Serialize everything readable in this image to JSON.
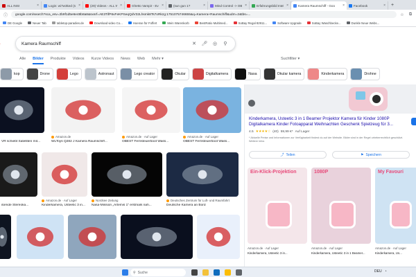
{
  "tabs": [
    {
      "label": "ALL INSI",
      "fav": "#c00"
    },
    {
      "label": "Login: wi7w3ked (sun-gc",
      "fav": "#4285f4"
    },
    {
      "label": "(29) Videos - ALL WHE",
      "fav": "#ff0000"
    },
    {
      "label": "Ghetto Vampir - Everyth",
      "fav": "#ff0000"
    },
    {
      "label": "(sun gun 1?",
      "fav": "#5f6368"
    },
    {
      "label": "Mind Control -> OBLETE",
      "fav": "#7b68ee"
    },
    {
      "label": "Erfahrungsbild Intelen v",
      "fav": "#34a853"
    },
    {
      "label": "Kamera Raumschiff - Goo",
      "fav": "#4285f4",
      "active": true
    },
    {
      "label": "Facebook",
      "fav": "#1877f2"
    }
  ],
  "tab_close": "×",
  "newtab": "+",
  "address": {
    "url": "google.com/search?sca_esv=2b9f1d5e6e48b8a8&sxsrf=AE3TifP6vFeKPSeqQdV32Lhsmk8Ts7oRkzg:1751075746655&q=Kamera+Raumschiff&udm=2&tbs=..."
  },
  "bookmarks": [
    {
      "label": "DE Google",
      "fav": "#4285f4"
    },
    {
      "label": "Neuer Tab",
      "fav": "#5f6368"
    },
    {
      "label": "tabletop-paradies.de",
      "fav": "#999"
    },
    {
      "label": "Download video Co...",
      "fav": "#ff0000"
    },
    {
      "label": "Hoense für Foffert",
      "fav": "#1877f2"
    },
    {
      "label": "Mein Warenkorb",
      "fav": "#34a853"
    },
    {
      "label": "BestRatio Multimed...",
      "fav": "#ea4335"
    },
    {
      "label": "SoBay Regal 82911...",
      "fav": "#e53238"
    },
    {
      "label": "Software Upgrade",
      "fav": "#4285f4"
    },
    {
      "label": "SoBay Waschbecke...",
      "fav": "#e53238"
    },
    {
      "label": "Dunkle Neue Webs...",
      "fav": "#5f6368"
    }
  ],
  "search": {
    "logo": "e",
    "query": "Kamera Raumschiff"
  },
  "nav": {
    "tabs": [
      "Alle",
      "Bilder",
      "Produkte",
      "Videos",
      "Kurze Videos",
      "News",
      "Web",
      "Mehr ▾"
    ],
    "active": "Bilder",
    "tools": "Suchfilter ▾"
  },
  "chips": [
    {
      "label": "kop",
      "color": "#8d9aa8"
    },
    {
      "label": "Drone",
      "color": "#444"
    },
    {
      "label": "Lego",
      "color": "#d43f3a"
    },
    {
      "label": "Astronaut",
      "color": "#bcc4cc"
    },
    {
      "label": "Lego creator",
      "color": "#7a8fa6"
    },
    {
      "label": "Okular",
      "color": "#222"
    },
    {
      "label": "Digitalkamera",
      "color": "#c44"
    },
    {
      "label": "Nasa",
      "color": "#111"
    },
    {
      "label": "Okular kamera",
      "color": "#333"
    },
    {
      "label": "Kinderkamera",
      "color": "#e88"
    },
    {
      "label": "Drohne",
      "color": "#6a8fb0"
    }
  ],
  "row1": [
    {
      "src": "",
      "title": "VR schiebt Satelliten mit...",
      "color": "#0b1020"
    },
    {
      "src": "Amazon.de",
      "title": "WLToys Q282 J Kamera Raumschiff...",
      "color": "#f3f3f3"
    },
    {
      "src": "Amazon.de · Auf Lager",
      "title": "OBEST Fernsteuerboot Wass...",
      "color": "#f5f5f5"
    },
    {
      "src": "Amazon.de · Auf Lager",
      "title": "OBEST Fernsteuerboot Wass...",
      "color": "#7ab3e0"
    }
  ],
  "row2": [
    {
      "src": "",
      "title": "ißende Stereoka...",
      "color": "#1a1a1a"
    },
    {
      "src": "Amazon.de · Auf Lager",
      "title": "Kinderkamera, Usteetic 3 in...",
      "color": "#f0e8e8"
    },
    {
      "src": "Nordsee Zeitung",
      "title": "Nasa-Mission „Artemis 1\" erstmals nah...",
      "color": "#050505"
    },
    {
      "src": "Deutsches Zentrum für Luft- und Raumfahrt",
      "title": "Deutsche Kamera an Bord",
      "color": "#1c2a44"
    }
  ],
  "row3": [
    {
      "color": "#0e1420"
    },
    {
      "color": "#cfe3f5"
    },
    {
      "color": "#8fa6bd"
    },
    {
      "color": "#0a0f1e"
    },
    {
      "color": "#e9f0fb"
    }
  ],
  "panel": {
    "title": "Kinderkamera, Usteetic 3 in 1 Beamer Projektor Kamera für Kinder 1080P Digitalkamera Kinder Fotoapparat Weihnachten Geschenk Spielzeug für 3...",
    "rating": "4.5",
    "stars": "★★★★☆",
    "count": "(40)",
    "price": "59,99 €*",
    "stock": "Auf Lager",
    "note": "* Aktuelle Preise und Informationen zur Verfügbarkeit findest du auf der Website. Bilder sind in der Regel urheberrechtlich geschützt. Weitere Infos",
    "share": "Teilen",
    "save": "Speichern",
    "ads": [
      {
        "src": "Amazon.de · Auf Lager",
        "title": "Kinderkamera, Usteetic 3 in...",
        "color": "#f4e6ea",
        "banner": "Ein-Klick-Projektion"
      },
      {
        "src": "Amazon.de · Auf Lager",
        "title": "Kinderkamera, Usteetic 3 in 1 Beamer...",
        "color": "#e9d2dc",
        "banner": "1080P"
      },
      {
        "src": "Amazon.de · Auf Lager",
        "title": "Kinderkamera, Us...",
        "color": "#cfe3f3",
        "banner": "My Favouri"
      }
    ]
  },
  "taskbar": {
    "search": "Suche",
    "time": "DEU"
  }
}
